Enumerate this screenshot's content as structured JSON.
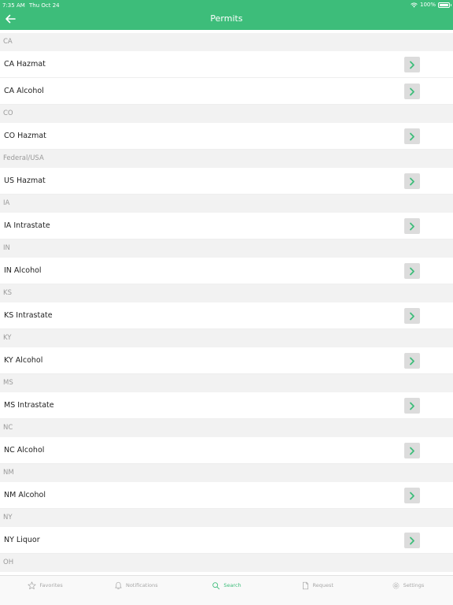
{
  "status_bar": {
    "time": "7:35 AM",
    "date": "Thu Oct 24",
    "battery": "100%"
  },
  "header": {
    "title": "Permits",
    "back_icon": "arrow-left-icon"
  },
  "colors": {
    "accent": "#3dbd7a",
    "section_bg": "#f2f2f2",
    "section_text": "#999999",
    "chevron_bg": "#dcdcdc"
  },
  "sections": [
    {
      "title": "CA",
      "rows": [
        "CA Hazmat",
        "CA Alcohol"
      ]
    },
    {
      "title": "CO",
      "rows": [
        "CO Hazmat"
      ]
    },
    {
      "title": "Federal/USA",
      "rows": [
        "US Hazmat"
      ]
    },
    {
      "title": "IA",
      "rows": [
        "IA Intrastate"
      ]
    },
    {
      "title": "IN",
      "rows": [
        "IN Alcohol"
      ]
    },
    {
      "title": "KS",
      "rows": [
        "KS Intrastate"
      ]
    },
    {
      "title": "KY",
      "rows": [
        "KY Alcohol"
      ]
    },
    {
      "title": "MS",
      "rows": [
        "MS Intrastate"
      ]
    },
    {
      "title": "NC",
      "rows": [
        "NC Alcohol"
      ]
    },
    {
      "title": "NM",
      "rows": [
        "NM Alcohol"
      ]
    },
    {
      "title": "NY",
      "rows": [
        "NY Liquor"
      ]
    },
    {
      "title": "OH",
      "rows": []
    }
  ],
  "tabs": [
    {
      "label": "Favorites",
      "icon": "star-icon",
      "active": false
    },
    {
      "label": "Notifications",
      "icon": "bell-icon",
      "active": false
    },
    {
      "label": "Search",
      "icon": "search-icon",
      "active": true
    },
    {
      "label": "Request",
      "icon": "document-icon",
      "active": false
    },
    {
      "label": "Settings",
      "icon": "gear-icon",
      "active": false
    }
  ]
}
